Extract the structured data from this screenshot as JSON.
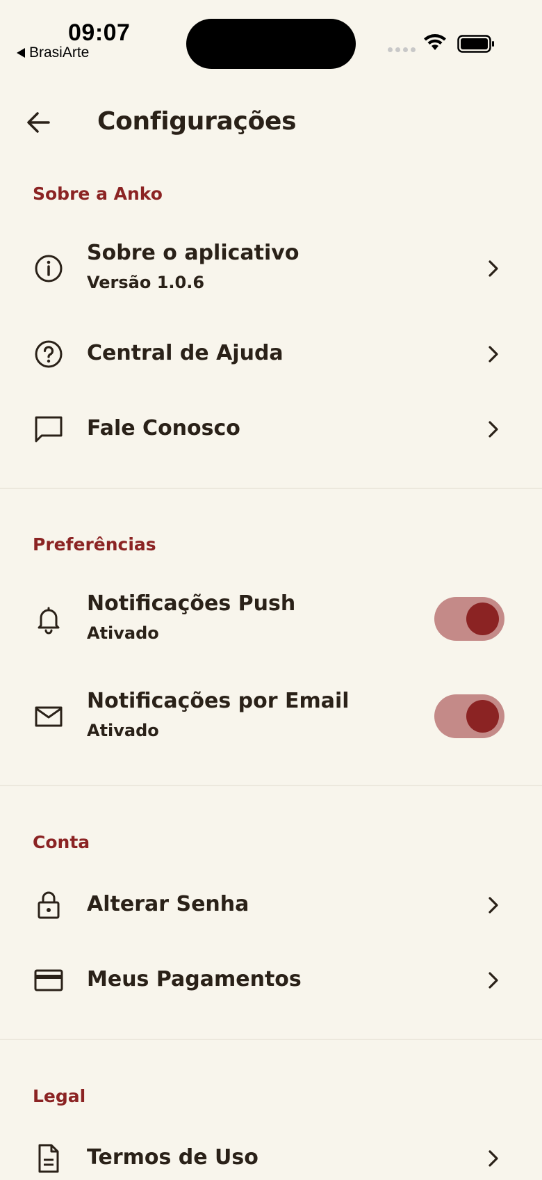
{
  "status_bar": {
    "time": "09:07",
    "back_app": "BrasiArte"
  },
  "header": {
    "title": "Configurações",
    "back_icon": "arrow-left-icon"
  },
  "sections": {
    "about": {
      "title": "Sobre a Anko",
      "items": [
        {
          "label": "Sobre o aplicativo",
          "sub": "Versão 1.0.6",
          "icon": "info-icon"
        },
        {
          "label": "Central de Ajuda",
          "icon": "help-circle-icon"
        },
        {
          "label": "Fale Conosco",
          "icon": "chat-bubble-icon"
        }
      ]
    },
    "preferences": {
      "title": "Preferências",
      "items": [
        {
          "label": "Notificações Push",
          "sub": "Ativado",
          "icon": "bell-icon",
          "enabled": true
        },
        {
          "label": "Notificações por Email",
          "sub": "Ativado",
          "icon": "mail-icon",
          "enabled": true
        }
      ]
    },
    "account": {
      "title": "Conta",
      "items": [
        {
          "label": "Alterar Senha",
          "icon": "lock-icon"
        },
        {
          "label": "Meus Pagamentos",
          "icon": "credit-card-icon"
        }
      ]
    },
    "legal": {
      "title": "Legal",
      "items": [
        {
          "label": "Termos de Uso",
          "icon": "document-icon"
        }
      ]
    }
  },
  "colors": {
    "background": "#f8f5ec",
    "accent": "#8b2323",
    "toggle_track": "#c48a88",
    "text": "#2a2118"
  }
}
